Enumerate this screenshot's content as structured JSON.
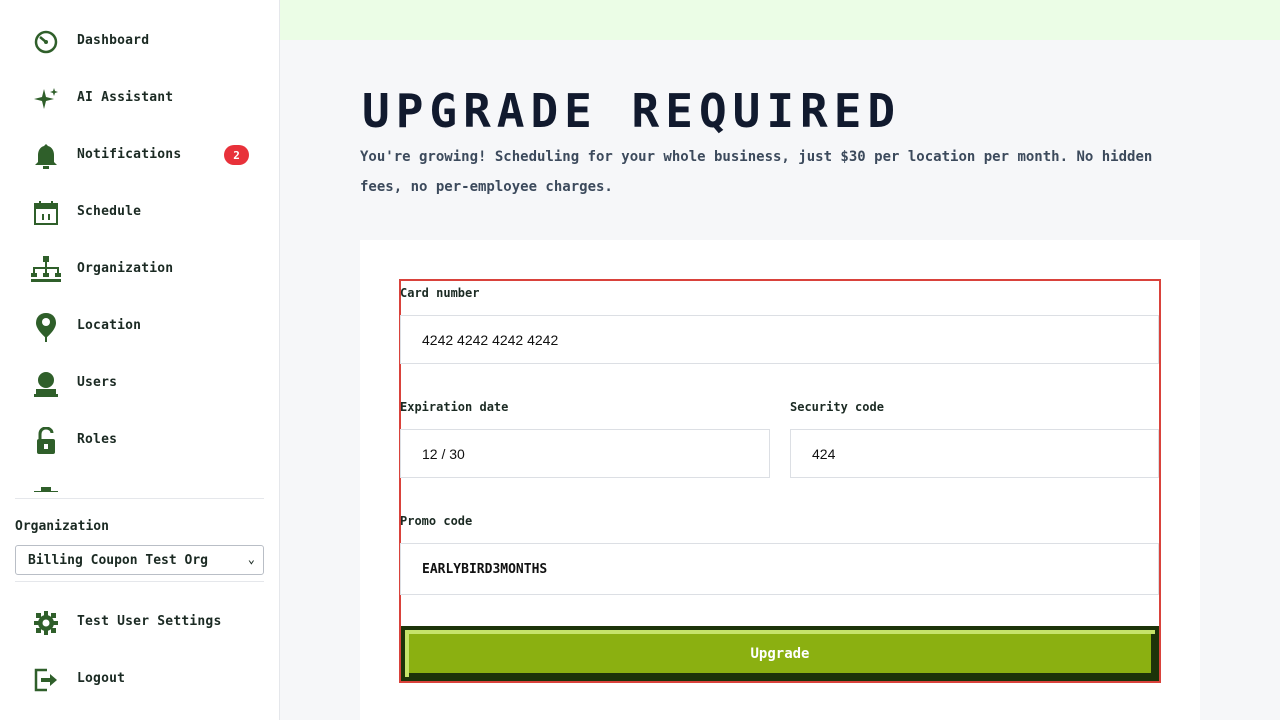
{
  "sidebar": {
    "items": [
      {
        "label": "Dashboard",
        "icon": "dashboard-icon"
      },
      {
        "label": "AI Assistant",
        "icon": "sparkle-icon"
      },
      {
        "label": "Notifications",
        "icon": "bell-icon",
        "badge": "2"
      },
      {
        "label": "Schedule",
        "icon": "calendar-icon"
      },
      {
        "label": "Organization",
        "icon": "org-chart-icon"
      },
      {
        "label": "Location",
        "icon": "location-pin-icon"
      },
      {
        "label": "Users",
        "icon": "user-icon"
      },
      {
        "label": "Roles",
        "icon": "unlock-icon"
      }
    ],
    "org_label": "Organization",
    "org_selected": "Billing Coupon Test Org",
    "bottom": [
      {
        "label": "Test User Settings",
        "icon": "gear-icon"
      },
      {
        "label": "Logout",
        "icon": "logout-icon"
      }
    ]
  },
  "main": {
    "title": "UPGRADE REQUIRED",
    "subtitle": "You're growing! Scheduling for your whole business, just $30 per location per month. No hidden fees, no per-employee charges."
  },
  "form": {
    "card_number_label": "Card number",
    "card_number_value": "4242 4242 4242 4242",
    "expiration_label": "Expiration date",
    "expiration_value": "12 / 30",
    "security_label": "Security code",
    "security_value": "424",
    "promo_label": "Promo code",
    "promo_value": "EARLYBIRD3MONTHS",
    "submit_label": "Upgrade"
  },
  "colors": {
    "icon_green": "#2f5f2a",
    "accent_button": "#8bb011",
    "badge": "#e8313a",
    "top_bar": "#ebfde6"
  }
}
